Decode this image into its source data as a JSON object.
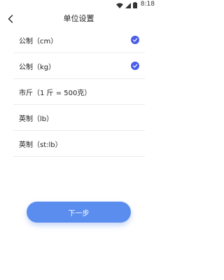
{
  "status_bar": {
    "time": "8:18",
    "icons": [
      "wifi-icon",
      "signal-icon",
      "battery-icon"
    ]
  },
  "header": {
    "back_icon": "chevron-left-icon",
    "title": "单位设置"
  },
  "options": [
    {
      "label": "公制（cm）",
      "checked": true
    },
    {
      "label": "公制（kg）",
      "checked": true
    },
    {
      "label": "市斤（1 斤 = 500克）",
      "checked": false
    },
    {
      "label": "英制（lb）",
      "checked": false
    },
    {
      "label": "英制（st:lb）",
      "checked": false
    }
  ],
  "next_button": {
    "label": "下一步"
  },
  "colors": {
    "accent": "#4a5ee8",
    "button": "#5b8def",
    "divider": "#ececec"
  }
}
